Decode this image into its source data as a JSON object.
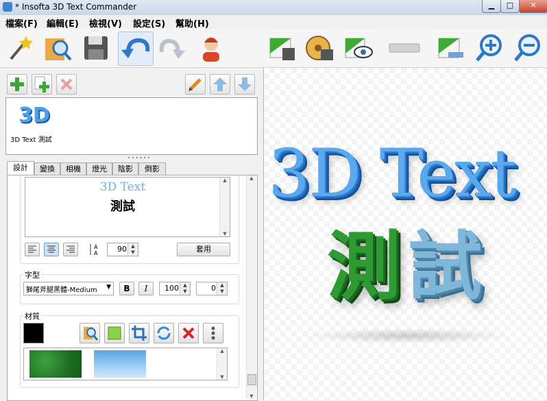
{
  "window": {
    "title": "* Insofta 3D Text Commander"
  },
  "menu": [
    "檔案(F)",
    "編輯(E)",
    "檢視(V)",
    "設定(S)",
    "幫助(H)"
  ],
  "toolbar": {
    "icons": [
      "wizard-icon",
      "open-search-icon",
      "save-icon",
      "undo-icon",
      "redo-icon",
      "support-icon",
      "export-image-icon",
      "export-video-icon",
      "preview-icon",
      "separator-bar-icon",
      "edit-image-icon",
      "zoom-in-icon",
      "zoom-out-icon"
    ]
  },
  "list": {
    "items": [
      {
        "thumb": "3D",
        "label": "3D Text 測試"
      }
    ]
  },
  "tabs": [
    "設計",
    "變換",
    "相機",
    "燈光",
    "陰影",
    "倒影"
  ],
  "design": {
    "preview_line1": "3D Text",
    "preview_line2": "測試",
    "line_spacing": "90",
    "apply_label": "套用"
  },
  "font": {
    "group_label": "字型",
    "family": "獅尾斧腿黑體-Medium",
    "bold_label": "B",
    "italic_label": "I",
    "size": "100",
    "spacing": "0"
  },
  "material": {
    "group_label": "材質",
    "swatch_color": "#000000"
  },
  "canvas": {
    "line1": "3D Text",
    "line2_a": "測",
    "line2_b": "試"
  },
  "colors": {
    "accent_blue": "#3a8fe3",
    "text_cyan": "#52c8ef",
    "grass_green": "#2a8a2a"
  }
}
